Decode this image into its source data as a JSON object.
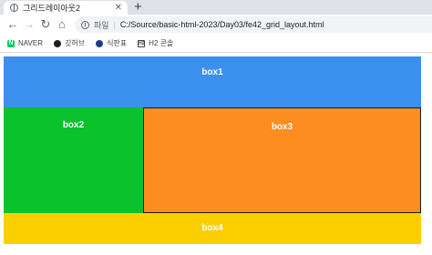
{
  "browser": {
    "tab_title": "그리드레이아웃2",
    "close_glyph": "✕",
    "new_tab_glyph": "+",
    "back_glyph": "←",
    "forward_glyph": "→",
    "reload_glyph": "↻",
    "home_glyph": "⌂",
    "address_prefix": "파일",
    "address_url": "C:/Source/basic-html-2023/Day03/fe42_grid_layout.html"
  },
  "bookmarks": [
    {
      "label": "NAVER",
      "icon": "naver-icon"
    },
    {
      "label": "깃허브",
      "icon": "github-icon"
    },
    {
      "label": "식판표",
      "icon": "eye-icon"
    },
    {
      "label": "H2 콘솔",
      "icon": "h2-icon"
    }
  ],
  "page": {
    "box1": "box1",
    "box2": "box2",
    "box3": "box3",
    "box4": "box4"
  },
  "colors": {
    "box1": "#3b8fef",
    "box2": "#0ac32c",
    "box3": "#fc8e1f",
    "box4": "#fcd000"
  }
}
